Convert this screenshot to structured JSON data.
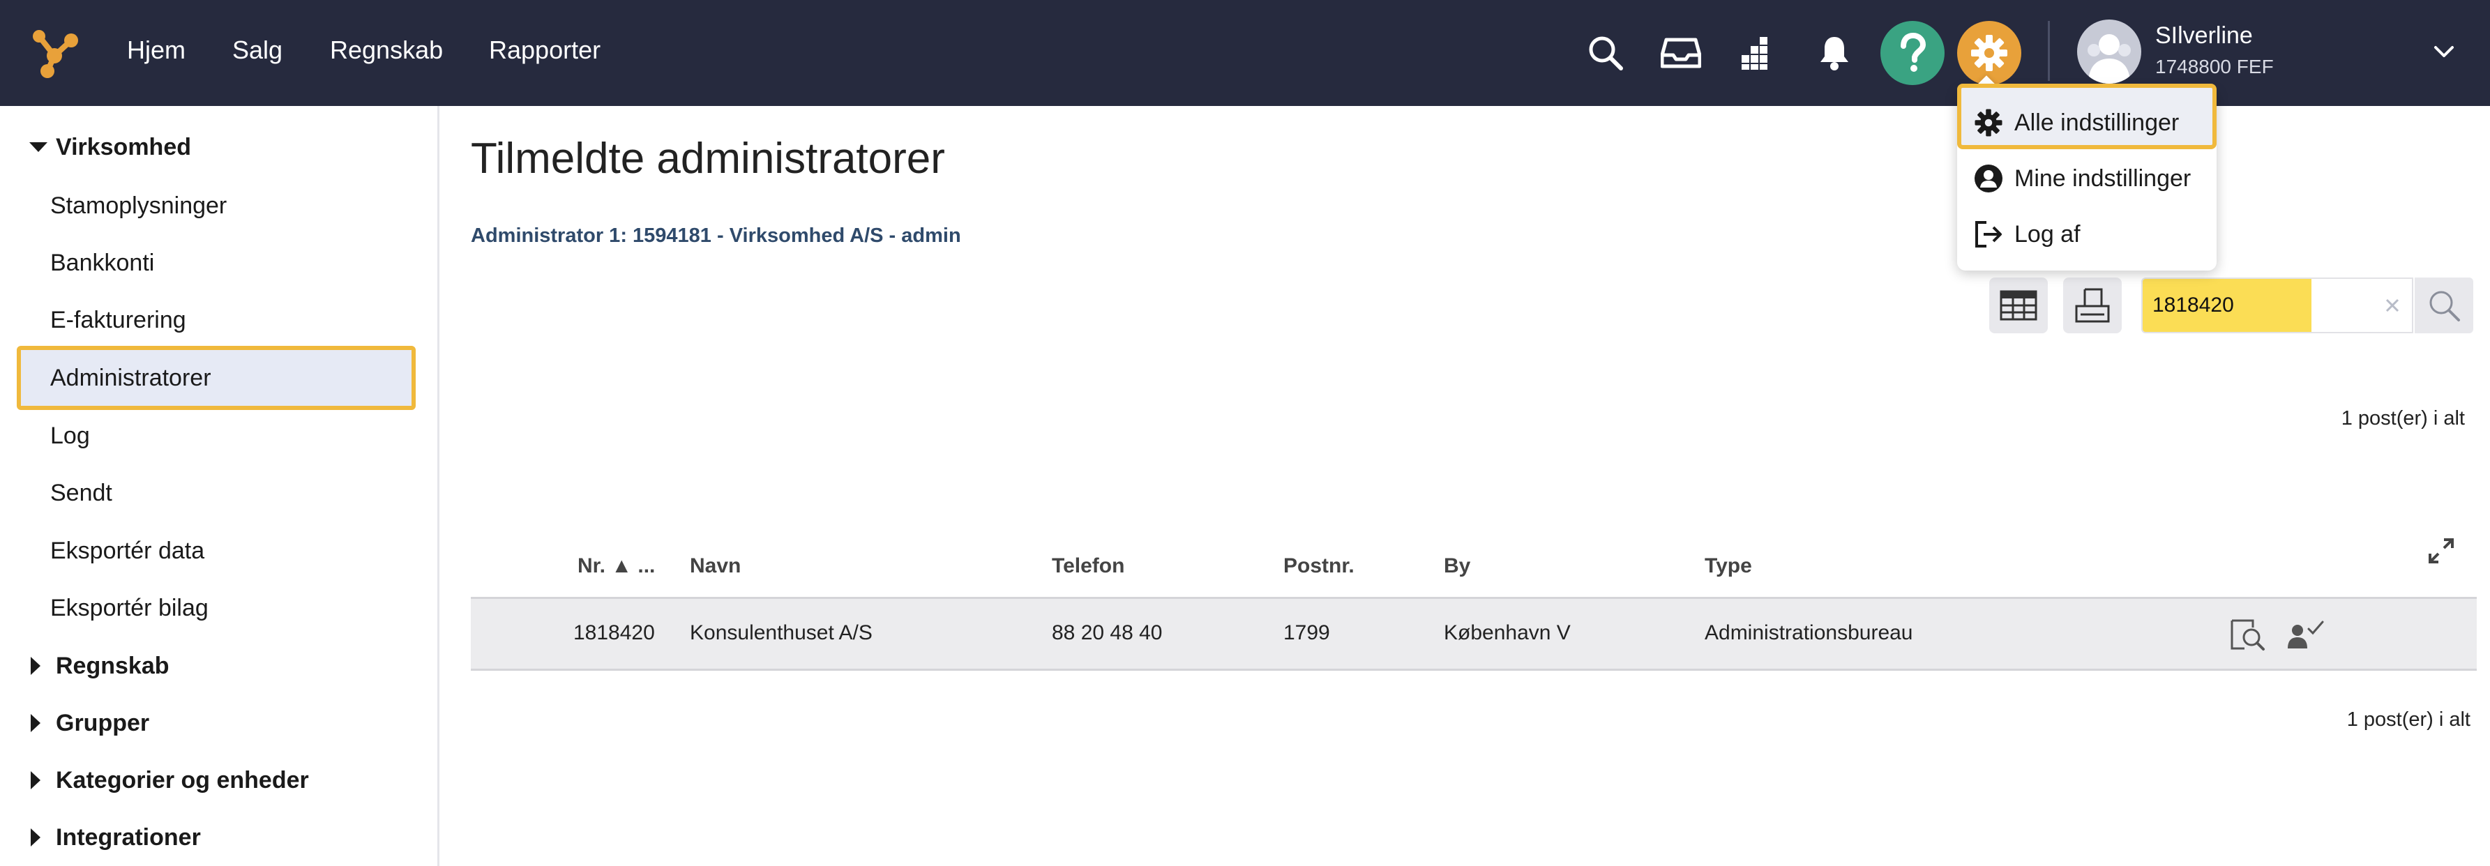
{
  "nav": {
    "items": [
      "Hjem",
      "Salg",
      "Regnskab",
      "Rapporter"
    ]
  },
  "user": {
    "name": "SIlverline",
    "sub": "1748800 FEF"
  },
  "dropdown": {
    "items": [
      {
        "label": "Alle indstillinger",
        "icon": "gear-icon"
      },
      {
        "label": "Mine indstillinger",
        "icon": "user-circle-icon"
      },
      {
        "label": "Log af",
        "icon": "logout-icon"
      }
    ]
  },
  "sidebar": {
    "group_open": "Virksomhed",
    "items": [
      "Stamoplysninger",
      "Bankkonti",
      "E-fakturering",
      "Administratorer",
      "Log",
      "Sendt",
      "Eksportér data",
      "Eksportér bilag"
    ],
    "groups_closed": [
      "Regnskab",
      "Grupper",
      "Kategorier og enheder",
      "Integrationer"
    ]
  },
  "main": {
    "title": "Tilmeldte administratorer",
    "admin_info": "Administrator 1: 1594181 - Virksomhed A/S - admin",
    "search_value": "1818420",
    "count_label": "1 post(er) i alt"
  },
  "table": {
    "headers": [
      "Nr. ▲ ...",
      "Navn",
      "Telefon",
      "Postnr.",
      "By",
      "Type"
    ],
    "rows": [
      [
        "1818420",
        "Konsulenthuset A/S",
        "88 20 48 40",
        "1799",
        "København V",
        "Administrationsbureau"
      ]
    ]
  },
  "colors": {
    "topbar": "#262a3e",
    "accent_orange": "#e8a13a",
    "help_green": "#3aa382",
    "highlight": "#f0b93c",
    "search_fill": "#fbdd55",
    "admin_info": "#2f4a6b"
  }
}
